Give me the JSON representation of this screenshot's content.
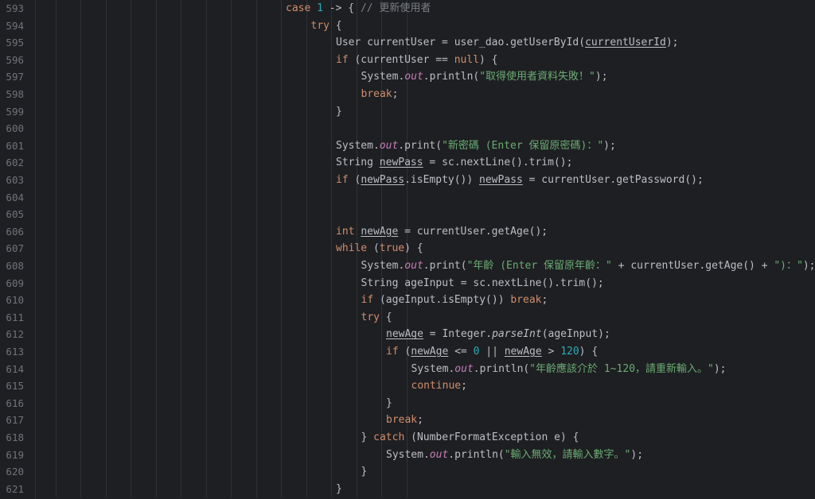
{
  "editor": {
    "colors": {
      "background": "#1e1f22",
      "line_number": "#6f737a",
      "plain": "#bcbec4",
      "keyword": "#cf8e6d",
      "number": "#2aacb8",
      "string": "#6aab73",
      "comment": "#7a7e85",
      "static_field": "#c77dbb"
    },
    "lines": [
      {
        "number": "593",
        "indent": 10,
        "tokens": [
          {
            "t": "case ",
            "s": "kw"
          },
          {
            "t": "1",
            "s": "num"
          },
          {
            "t": " -> { "
          },
          {
            "t": "// 更新使用者",
            "s": "cmt"
          }
        ]
      },
      {
        "number": "594",
        "indent": 11,
        "tokens": [
          {
            "t": "try",
            "s": "kw"
          },
          {
            "t": " {"
          }
        ]
      },
      {
        "number": "595",
        "indent": 12,
        "tokens": [
          {
            "t": "User currentUser = user_dao.getUserById("
          },
          {
            "t": "currentUserId",
            "s": "ul"
          },
          {
            "t": ");"
          }
        ]
      },
      {
        "number": "596",
        "indent": 12,
        "tokens": [
          {
            "t": "if",
            "s": "kw"
          },
          {
            "t": " (currentUser == "
          },
          {
            "t": "null",
            "s": "kw"
          },
          {
            "t": ") {"
          }
        ]
      },
      {
        "number": "597",
        "indent": 13,
        "tokens": [
          {
            "t": "System."
          },
          {
            "t": "out",
            "s": "fld"
          },
          {
            "t": ".println("
          },
          {
            "t": "\"取得使用者資料失敗！\"",
            "s": "str"
          },
          {
            "t": ");"
          }
        ]
      },
      {
        "number": "598",
        "indent": 13,
        "tokens": [
          {
            "t": "break",
            "s": "kw"
          },
          {
            "t": ";"
          }
        ]
      },
      {
        "number": "599",
        "indent": 12,
        "tokens": [
          {
            "t": "}"
          }
        ]
      },
      {
        "number": "600",
        "indent": 0,
        "tokens": []
      },
      {
        "number": "601",
        "indent": 12,
        "tokens": [
          {
            "t": "System."
          },
          {
            "t": "out",
            "s": "fld"
          },
          {
            "t": ".print("
          },
          {
            "t": "\"新密碼 (Enter 保留原密碼)：\"",
            "s": "str"
          },
          {
            "t": ");"
          }
        ]
      },
      {
        "number": "602",
        "indent": 12,
        "tokens": [
          {
            "t": "String "
          },
          {
            "t": "newPass",
            "s": "ul"
          },
          {
            "t": " = sc.nextLine().trim();"
          }
        ]
      },
      {
        "number": "603",
        "indent": 12,
        "tokens": [
          {
            "t": "if",
            "s": "kw"
          },
          {
            "t": " ("
          },
          {
            "t": "newPass",
            "s": "ul"
          },
          {
            "t": ".isEmpty()) "
          },
          {
            "t": "newPass",
            "s": "ul"
          },
          {
            "t": " = currentUser.getPassword();"
          }
        ]
      },
      {
        "number": "604",
        "indent": 0,
        "tokens": []
      },
      {
        "number": "605",
        "indent": 0,
        "tokens": []
      },
      {
        "number": "606",
        "indent": 12,
        "tokens": [
          {
            "t": "int ",
            "s": "kw"
          },
          {
            "t": "newAge",
            "s": "ul"
          },
          {
            "t": " = currentUser.getAge();"
          }
        ]
      },
      {
        "number": "607",
        "indent": 12,
        "tokens": [
          {
            "t": "while",
            "s": "kw"
          },
          {
            "t": " ("
          },
          {
            "t": "true",
            "s": "kw"
          },
          {
            "t": ") {"
          }
        ]
      },
      {
        "number": "608",
        "indent": 13,
        "tokens": [
          {
            "t": "System."
          },
          {
            "t": "out",
            "s": "fld"
          },
          {
            "t": ".print("
          },
          {
            "t": "\"年齡 (Enter 保留原年齡：\"",
            "s": "str"
          },
          {
            "t": " + currentUser.getAge() + "
          },
          {
            "t": "\")：\"",
            "s": "str"
          },
          {
            "t": ");"
          }
        ]
      },
      {
        "number": "609",
        "indent": 13,
        "tokens": [
          {
            "t": "String ageInput = sc.nextLine().trim();"
          }
        ]
      },
      {
        "number": "610",
        "indent": 13,
        "tokens": [
          {
            "t": "if",
            "s": "kw"
          },
          {
            "t": " (ageInput.isEmpty()) "
          },
          {
            "t": "break",
            "s": "kw"
          },
          {
            "t": ";"
          }
        ]
      },
      {
        "number": "611",
        "indent": 13,
        "tokens": [
          {
            "t": "try",
            "s": "kw"
          },
          {
            "t": " {"
          }
        ]
      },
      {
        "number": "612",
        "indent": 14,
        "tokens": [
          {
            "t": "newAge",
            "s": "ul"
          },
          {
            "t": " = Integer."
          },
          {
            "t": "parseInt",
            "s": "ital"
          },
          {
            "t": "(ageInput);"
          }
        ]
      },
      {
        "number": "613",
        "indent": 14,
        "tokens": [
          {
            "t": "if",
            "s": "kw"
          },
          {
            "t": " ("
          },
          {
            "t": "newAge",
            "s": "ul"
          },
          {
            "t": " <= "
          },
          {
            "t": "0",
            "s": "num"
          },
          {
            "t": " || "
          },
          {
            "t": "newAge",
            "s": "ul"
          },
          {
            "t": " > "
          },
          {
            "t": "120",
            "s": "num"
          },
          {
            "t": ") {"
          }
        ]
      },
      {
        "number": "614",
        "indent": 15,
        "tokens": [
          {
            "t": "System."
          },
          {
            "t": "out",
            "s": "fld"
          },
          {
            "t": ".println("
          },
          {
            "t": "\"年齡應該介於 1~120，請重新輸入。\"",
            "s": "str"
          },
          {
            "t": ");"
          }
        ]
      },
      {
        "number": "615",
        "indent": 15,
        "tokens": [
          {
            "t": "continue",
            "s": "kw"
          },
          {
            "t": ";"
          }
        ]
      },
      {
        "number": "616",
        "indent": 14,
        "tokens": [
          {
            "t": "}"
          }
        ]
      },
      {
        "number": "617",
        "indent": 14,
        "tokens": [
          {
            "t": "break",
            "s": "kw"
          },
          {
            "t": ";"
          }
        ]
      },
      {
        "number": "618",
        "indent": 13,
        "tokens": [
          {
            "t": "} "
          },
          {
            "t": "catch",
            "s": "kw"
          },
          {
            "t": " (NumberFormatException e) {"
          }
        ]
      },
      {
        "number": "619",
        "indent": 14,
        "tokens": [
          {
            "t": "System."
          },
          {
            "t": "out",
            "s": "fld"
          },
          {
            "t": ".println("
          },
          {
            "t": "\"輸入無效，請輸入數字。\"",
            "s": "str"
          },
          {
            "t": ");"
          }
        ]
      },
      {
        "number": "620",
        "indent": 13,
        "tokens": [
          {
            "t": "}"
          }
        ]
      },
      {
        "number": "621",
        "indent": 12,
        "tokens": [
          {
            "t": "}"
          }
        ]
      }
    ]
  }
}
